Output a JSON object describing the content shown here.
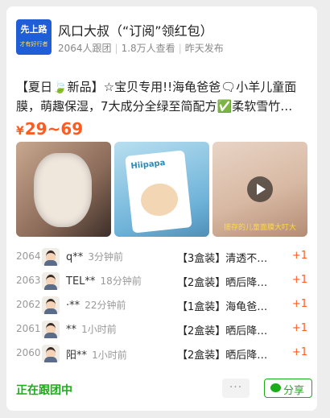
{
  "header": {
    "avatar_text": "先上路",
    "avatar_sub": "才有好行者",
    "title": "风口大叔（“订阅”领红包）",
    "followers": "2064人跟团",
    "views": "1.8万人查看",
    "posted": "昨天发布"
  },
  "product": {
    "description": "【夏日🍃新品】☆宝贝专用!!海龟爸爸🗨小羊儿童面膜，萌趣保湿，7大成分全绿至简配方✅柔软雪竹…",
    "currency": "¥",
    "price_range": "29~69",
    "pack_brand": "Hiipapa",
    "video_caption": "搓存的儿童面膜大叮大"
  },
  "orders": [
    {
      "num": "2064",
      "name": "q**",
      "time": "3分钟前",
      "item": "【3盒装】清透不…",
      "qty": "+1"
    },
    {
      "num": "2063",
      "name": "TEL**",
      "time": "18分钟前",
      "item": "【2盒装】晒后降…",
      "qty": "+1"
    },
    {
      "num": "2062",
      "name": "·**",
      "time": "22分钟前",
      "item": "【1盒装】海龟爸…",
      "qty": "+1"
    },
    {
      "num": "2061",
      "name": "**",
      "time": "1小时前",
      "item": "【2盒装】晒后降…",
      "qty": "+1"
    },
    {
      "num": "2060",
      "name": "阳**",
      "time": "1小时前",
      "item": "【2盒装】晒后降…",
      "qty": "+1"
    }
  ],
  "footer": {
    "status": "正在跟团中",
    "more": "···",
    "share": "分享"
  },
  "colors": {
    "accent": "#ff5a1f",
    "wechat_green": "#1aad19"
  }
}
